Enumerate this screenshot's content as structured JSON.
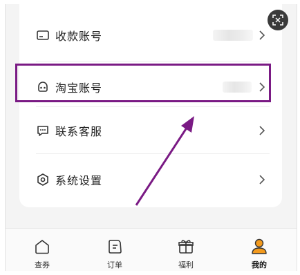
{
  "menu": {
    "items": [
      {
        "label": "收款账号",
        "icon": "card-icon"
      },
      {
        "label": "淘宝账号",
        "icon": "taobao-icon"
      },
      {
        "label": "联系客服",
        "icon": "chat-bubble-icon"
      },
      {
        "label": "系统设置",
        "icon": "settings-icon"
      }
    ]
  },
  "tabbar": {
    "tabs": [
      {
        "label": "查券",
        "icon": "home-icon",
        "active": false
      },
      {
        "label": "订单",
        "icon": "order-icon",
        "active": false
      },
      {
        "label": "福利",
        "icon": "gift-icon",
        "active": false
      },
      {
        "label": "我的",
        "icon": "user-icon",
        "active": true
      }
    ]
  },
  "colors": {
    "highlight": "#7a1a84",
    "active_tab": "#f39a1d",
    "background": "#f4f4f4"
  }
}
